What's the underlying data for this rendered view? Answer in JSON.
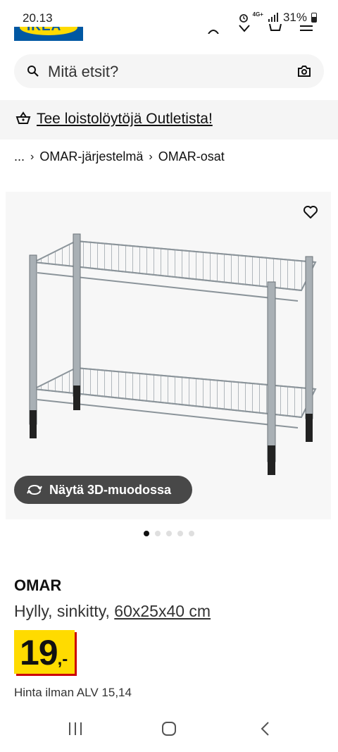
{
  "status_bar": {
    "time": "20.13",
    "network": "4G+",
    "battery": "31%"
  },
  "search": {
    "placeholder": "Mitä etsit?"
  },
  "promo": {
    "text": "Tee loistolöytöjä Outletista!"
  },
  "breadcrumb": {
    "ellipsis": "...",
    "items": [
      "OMAR-järjestelmä",
      "OMAR-osat"
    ]
  },
  "gallery": {
    "view_3d_label": "Näytä 3D-muodossa",
    "image_count": 5,
    "active_index": 0
  },
  "product": {
    "name": "OMAR",
    "description": "Hylly, sinkitty,",
    "dimensions": "60x25x40 cm",
    "price_integer": "19",
    "price_decimal": ",-",
    "vat_text": "Hinta ilman ALV 15,14"
  },
  "colors": {
    "brand_blue": "#0058a3",
    "brand_yellow": "#ffdb00",
    "price_shadow": "#cc0008"
  },
  "icons": [
    "search-icon",
    "camera-icon",
    "outlet-basket-icon",
    "heart-icon",
    "rotate-3d-icon",
    "recent-apps-icon",
    "home-icon",
    "back-icon"
  ]
}
